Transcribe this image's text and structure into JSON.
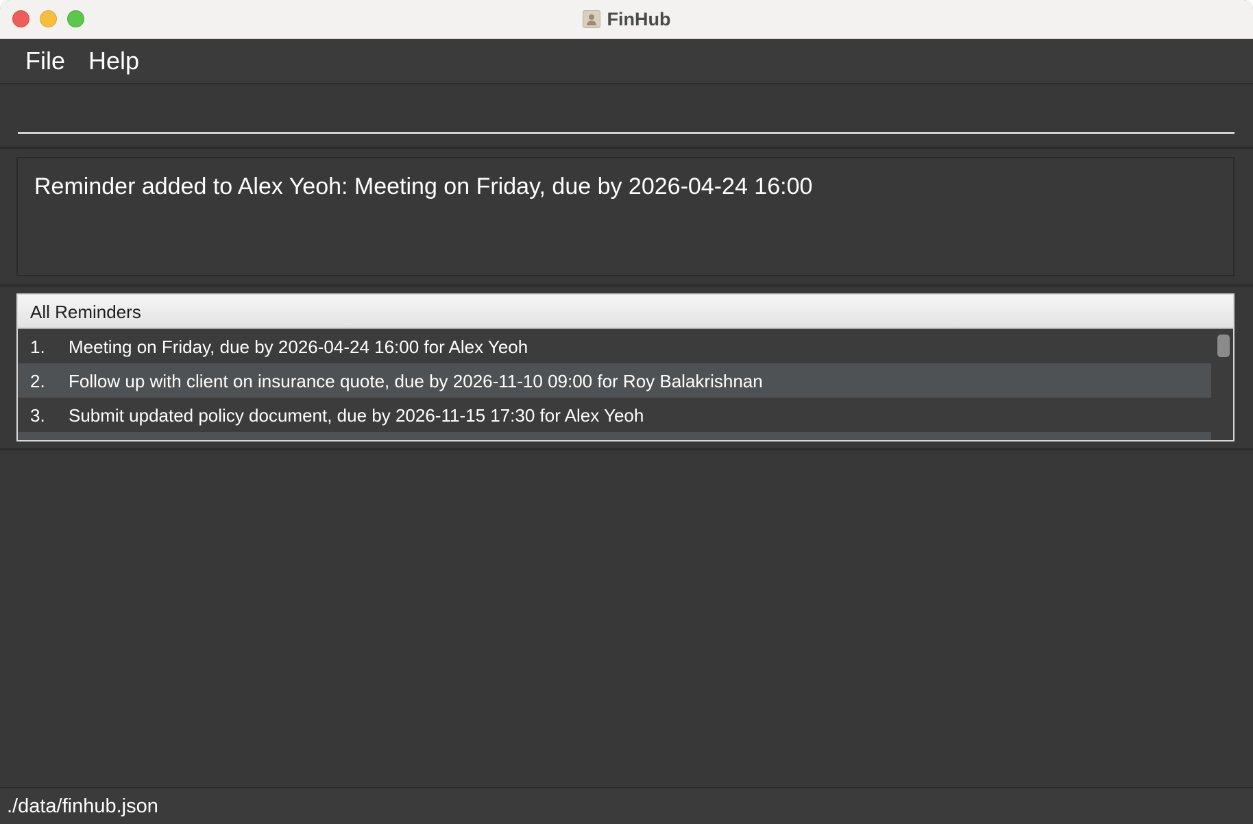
{
  "window": {
    "title": "FinHub"
  },
  "menu": {
    "items": [
      {
        "label": "File"
      },
      {
        "label": "Help"
      }
    ]
  },
  "command_box": {
    "value": "",
    "placeholder": ""
  },
  "result_display": {
    "message": "Reminder added to Alex Yeoh: Meeting on Friday, due by 2026-04-24 16:00"
  },
  "reminder_list": {
    "title": "All Reminders",
    "items": [
      {
        "index": "1.",
        "text": "Meeting on Friday, due by 2026-04-24 16:00 for Alex Yeoh"
      },
      {
        "index": "2.",
        "text": "Follow up with client on insurance quote, due by 2026-11-10 09:00 for Roy Balakrishnan"
      },
      {
        "index": "3.",
        "text": "Submit updated policy document, due by 2026-11-15 17:30 for Alex Yeoh"
      }
    ]
  },
  "status_bar": {
    "file_path": "./data/finhub.json"
  },
  "colors": {
    "background": "#383838",
    "row_alt": "#4f5254",
    "text": "#ffffff"
  },
  "icons": {
    "app": "contact-book-icon"
  }
}
